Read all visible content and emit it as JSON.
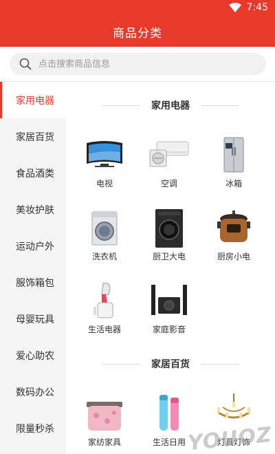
{
  "status": {
    "time": "7:45"
  },
  "header": {
    "title": "商品分类"
  },
  "search": {
    "placeholder": "点击搜索商品信息"
  },
  "sidebar": {
    "items": [
      {
        "label": "家用电器"
      },
      {
        "label": "家居百货"
      },
      {
        "label": "食品酒类"
      },
      {
        "label": "美妆护肤"
      },
      {
        "label": "运动户外"
      },
      {
        "label": "服饰箱包"
      },
      {
        "label": "母婴玩具"
      },
      {
        "label": "爱心助农"
      },
      {
        "label": "数码办公"
      },
      {
        "label": "限量秒杀"
      }
    ],
    "active_index": 0
  },
  "sections": [
    {
      "title": "家用电器",
      "items": [
        {
          "label": "电视",
          "icon": "tv-icon"
        },
        {
          "label": "空调",
          "icon": "air-conditioner-icon"
        },
        {
          "label": "冰箱",
          "icon": "fridge-icon"
        },
        {
          "label": "洗衣机",
          "icon": "washing-machine-icon"
        },
        {
          "label": "厨卫大电",
          "icon": "kitchen-appliance-icon"
        },
        {
          "label": "厨房小电",
          "icon": "rice-cooker-icon"
        },
        {
          "label": "生活电器",
          "icon": "steamer-icon"
        },
        {
          "label": "家庭影音",
          "icon": "speaker-icon"
        }
      ]
    },
    {
      "title": "家居百货",
      "items": [
        {
          "label": "家纺家具",
          "icon": "bedding-icon"
        },
        {
          "label": "生活日用",
          "icon": "bottle-icon"
        },
        {
          "label": "灯具灯饰",
          "icon": "chandelier-icon"
        }
      ]
    }
  ],
  "colors": {
    "brand": "#e83a2c",
    "sidebar_bg": "#f5f5f5"
  },
  "watermark": {
    "text": "YOUOZ"
  }
}
